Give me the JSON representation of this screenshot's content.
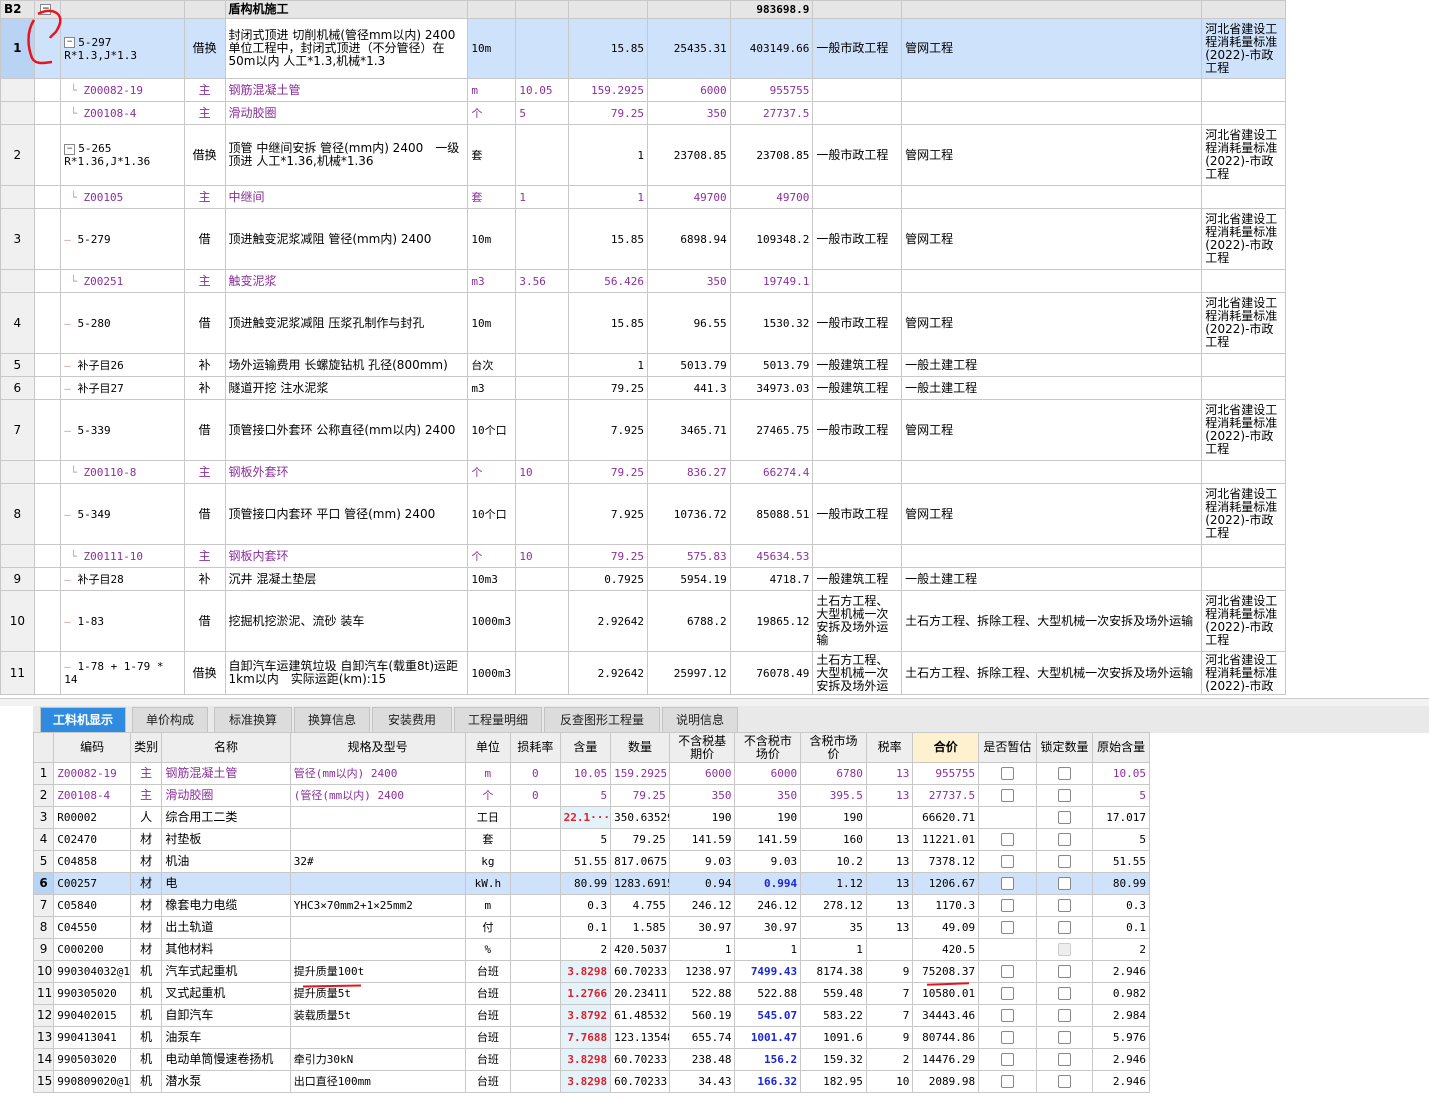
{
  "upper": {
    "title_row": {
      "code": "B2",
      "name": "盾构机施工",
      "total": "983698.9"
    },
    "rows": [
      {
        "num": "1",
        "code": "5-297",
        "code2": "R*1.3,J*1.3",
        "type": "借换",
        "name": "封闭式顶进 切削机械(管径mm以内) 2400 单位工程中，封闭式顶进（不分管径）在50m以内 人工*1.3,机械*1.3",
        "unit": "10m",
        "loss": "",
        "qty": "15.85",
        "price": "25435.31",
        "total": "403149.66",
        "prof": "一般市政工程",
        "cat": "管网工程",
        "std": "河北省建设工程消耗量标准(2022)-市政工程"
      },
      {
        "num": "",
        "code": "Z00082-19",
        "type": "主",
        "name": "钢筋混凝土管",
        "unit": "m",
        "loss": "10.05",
        "qty": "159.2925",
        "price": "6000",
        "total": "955755",
        "prof": "",
        "cat": "",
        "std": ""
      },
      {
        "num": "",
        "code": "Z00108-4",
        "type": "主",
        "name": "滑动胶圈",
        "unit": "个",
        "loss": "5",
        "qty": "79.25",
        "price": "350",
        "total": "27737.5",
        "prof": "",
        "cat": "",
        "std": ""
      },
      {
        "num": "2",
        "code": "5-265",
        "code2": "R*1.36,J*1.36",
        "type": "借换",
        "name": "顶管 中继间安拆 管径(mm内) 2400　一级顶进 人工*1.36,机械*1.36",
        "unit": "套",
        "loss": "",
        "qty": "1",
        "price": "23708.85",
        "total": "23708.85",
        "prof": "一般市政工程",
        "cat": "管网工程",
        "std": "河北省建设工程消耗量标准(2022)-市政工程"
      },
      {
        "num": "",
        "code": "Z00105",
        "type": "主",
        "name": "中继间",
        "unit": "套",
        "loss": "1",
        "qty": "1",
        "price": "49700",
        "total": "49700",
        "prof": "",
        "cat": "",
        "std": ""
      },
      {
        "num": "3",
        "code": "5-279",
        "type": "借",
        "name": "顶进触变泥浆减阻 管径(mm内) 2400",
        "unit": "10m",
        "loss": "",
        "qty": "15.85",
        "price": "6898.94",
        "total": "109348.2",
        "prof": "一般市政工程",
        "cat": "管网工程",
        "std": "河北省建设工程消耗量标准(2022)-市政工程"
      },
      {
        "num": "",
        "code": "Z00251",
        "type": "主",
        "name": "触变泥浆",
        "unit": "m3",
        "loss": "3.56",
        "qty": "56.426",
        "price": "350",
        "total": "19749.1",
        "prof": "",
        "cat": "",
        "std": ""
      },
      {
        "num": "4",
        "code": "5-280",
        "type": "借",
        "name": "顶进触变泥浆减阻 压浆孔制作与封孔",
        "unit": "10m",
        "loss": "",
        "qty": "15.85",
        "price": "96.55",
        "total": "1530.32",
        "prof": "一般市政工程",
        "cat": "管网工程",
        "std": "河北省建设工程消耗量标准(2022)-市政工程"
      },
      {
        "num": "5",
        "code": "补子目26",
        "type": "补",
        "name": "场外运输费用 长螺旋钻机 孔径(800mm)",
        "unit": "台次",
        "loss": "",
        "qty": "1",
        "price": "5013.79",
        "total": "5013.79",
        "prof": "一般建筑工程",
        "cat": "一般土建工程",
        "std": ""
      },
      {
        "num": "6",
        "code": "补子目27",
        "type": "补",
        "name": "隧道开挖 注水泥浆",
        "unit": "m3",
        "loss": "",
        "qty": "79.25",
        "price": "441.3",
        "total": "34973.03",
        "prof": "一般建筑工程",
        "cat": "一般土建工程",
        "std": ""
      },
      {
        "num": "7",
        "code": "5-339",
        "type": "借",
        "name": "顶管接口外套环 公称直径(mm以内) 2400",
        "unit": "10个口",
        "loss": "",
        "qty": "7.925",
        "price": "3465.71",
        "total": "27465.75",
        "prof": "一般市政工程",
        "cat": "管网工程",
        "std": "河北省建设工程消耗量标准(2022)-市政工程"
      },
      {
        "num": "",
        "code": "Z00110-8",
        "type": "主",
        "name": "钢板外套环",
        "unit": "个",
        "loss": "10",
        "qty": "79.25",
        "price": "836.27",
        "total": "66274.4",
        "prof": "",
        "cat": "",
        "std": ""
      },
      {
        "num": "8",
        "code": "5-349",
        "type": "借",
        "name": "顶管接口内套环 平口 管径(mm) 2400",
        "unit": "10个口",
        "loss": "",
        "qty": "7.925",
        "price": "10736.72",
        "total": "85088.51",
        "prof": "一般市政工程",
        "cat": "管网工程",
        "std": "河北省建设工程消耗量标准(2022)-市政工程"
      },
      {
        "num": "",
        "code": "Z00111-10",
        "type": "主",
        "name": "钢板内套环",
        "unit": "个",
        "loss": "10",
        "qty": "79.25",
        "price": "575.83",
        "total": "45634.53",
        "prof": "",
        "cat": "",
        "std": ""
      },
      {
        "num": "9",
        "code": "补子目28",
        "type": "补",
        "name": "沉井 混凝土垫层",
        "unit": "10m3",
        "loss": "",
        "qty": "0.7925",
        "price": "5954.19",
        "total": "4718.7",
        "prof": "一般建筑工程",
        "cat": "一般土建工程",
        "std": ""
      },
      {
        "num": "10",
        "code": "1-83",
        "type": "借",
        "name": "挖掘机挖淤泥、流砂 装车",
        "unit": "1000m3",
        "loss": "",
        "qty": "2.92642",
        "price": "6788.2",
        "total": "19865.12",
        "prof": "土石方工程、大型机械一次安拆及场外运输",
        "cat": "土石方工程、拆除工程、大型机械一次安拆及场外运输",
        "std": "河北省建设工程消耗量标准(2022)-市政工程"
      },
      {
        "num": "11",
        "code": "1-78 + 1-79 * 14",
        "type": "借换",
        "name": "自卸汽车运建筑垃圾 自卸汽车(载重8t)运距1km以内　实际运距(km):15",
        "unit": "1000m3",
        "loss": "",
        "qty": "2.92642",
        "price": "25997.12",
        "total": "76078.49",
        "prof": "土石方工程、大型机械一次安拆及场外运",
        "cat": "土石方工程、拆除工程、大型机械一次安拆及场外运输",
        "std": "河北省建设工程消耗量标准(2022)-市政"
      }
    ]
  },
  "tabs": [
    "工料机显示",
    "单价构成",
    "标准换算",
    "换算信息",
    "安装费用",
    "工程量明细",
    "反查图形工程量",
    "说明信息"
  ],
  "lower": {
    "headers": [
      "编码",
      "类别",
      "名称",
      "规格及型号",
      "单位",
      "损耗率",
      "含量",
      "数量",
      "不含税基期价",
      "不含税市场价",
      "含税市场价",
      "税率",
      "合价",
      "是否暂估",
      "锁定数量",
      "原始含量"
    ],
    "rows": [
      {
        "num": "1",
        "code": "Z00082-19",
        "cat": "主",
        "name": "钢筋混凝土管",
        "spec": "管径(mm以内) 2400",
        "unit": "m",
        "loss": "0",
        "content": "10.05",
        "qty": "159.2925",
        "base": "6000",
        "market": "6000",
        "taxmarket": "6780",
        "rate": "13",
        "total": "955755",
        "orig": "10.05"
      },
      {
        "num": "2",
        "code": "Z00108-4",
        "cat": "主",
        "name": "滑动胶圈",
        "spec": "(管径(mm以内) 2400",
        "unit": "个",
        "loss": "0",
        "content": "5",
        "qty": "79.25",
        "base": "350",
        "market": "350",
        "taxmarket": "395.5",
        "rate": "13",
        "total": "27737.5",
        "orig": "5"
      },
      {
        "num": "3",
        "code": "R00002",
        "cat": "人",
        "name": "综合用工二类",
        "spec": "",
        "unit": "工日",
        "loss": "",
        "content": "22.1···",
        "qty": "350.63529",
        "base": "190",
        "market": "190",
        "taxmarket": "190",
        "rate": "",
        "total": "66620.71",
        "orig": "17.017"
      },
      {
        "num": "4",
        "code": "C02470",
        "cat": "材",
        "name": "衬垫板",
        "spec": "",
        "unit": "套",
        "loss": "",
        "content": "5",
        "qty": "79.25",
        "base": "141.59",
        "market": "141.59",
        "taxmarket": "160",
        "rate": "13",
        "total": "11221.01",
        "orig": "5"
      },
      {
        "num": "5",
        "code": "C04858",
        "cat": "材",
        "name": "机油",
        "spec": "32#",
        "unit": "kg",
        "loss": "",
        "content": "51.55",
        "qty": "817.0675",
        "base": "9.03",
        "market": "9.03",
        "taxmarket": "10.2",
        "rate": "13",
        "total": "7378.12",
        "orig": "51.55"
      },
      {
        "num": "6",
        "code": "C00257",
        "cat": "材",
        "name": "电",
        "spec": "",
        "unit": "kW.h",
        "loss": "",
        "content": "80.99",
        "qty": "1283.6915",
        "base": "0.94",
        "market": "0.994",
        "taxmarket": "1.12",
        "rate": "13",
        "total": "1206.67",
        "orig": "80.99"
      },
      {
        "num": "7",
        "code": "C05840",
        "cat": "材",
        "name": "橡套电力电缆",
        "spec": "YHC3×70mm2+1×25mm2",
        "unit": "m",
        "loss": "",
        "content": "0.3",
        "qty": "4.755",
        "base": "246.12",
        "market": "246.12",
        "taxmarket": "278.12",
        "rate": "13",
        "total": "1170.3",
        "orig": "0.3"
      },
      {
        "num": "8",
        "code": "C04550",
        "cat": "材",
        "name": "出土轨道",
        "spec": "",
        "unit": "付",
        "loss": "",
        "content": "0.1",
        "qty": "1.585",
        "base": "30.97",
        "market": "30.97",
        "taxmarket": "35",
        "rate": "13",
        "total": "49.09",
        "orig": "0.1"
      },
      {
        "num": "9",
        "code": "C000200",
        "cat": "材",
        "name": "其他材料",
        "spec": "",
        "unit": "%",
        "loss": "",
        "content": "2",
        "qty": "420.5037",
        "base": "1",
        "market": "1",
        "taxmarket": "1",
        "rate": "",
        "total": "420.5",
        "orig": "2"
      },
      {
        "num": "10",
        "code": "990304032@1",
        "cat": "机",
        "name": "汽车式起重机",
        "spec": "提升质量100t",
        "unit": "台班",
        "loss": "",
        "content": "3.8298",
        "qty": "60.70233",
        "base": "1238.97",
        "market": "7499.43",
        "taxmarket": "8174.38",
        "rate": "9",
        "total": "75208.37",
        "orig": "2.946"
      },
      {
        "num": "11",
        "code": "990305020",
        "cat": "机",
        "name": "叉式起重机",
        "spec": "提升质量5t",
        "unit": "台班",
        "loss": "",
        "content": "1.2766",
        "qty": "20.23411",
        "base": "522.88",
        "market": "522.88",
        "taxmarket": "559.48",
        "rate": "7",
        "total": "10580.01",
        "orig": "0.982"
      },
      {
        "num": "12",
        "code": "990402015",
        "cat": "机",
        "name": "自卸汽车",
        "spec": "装载质量5t",
        "unit": "台班",
        "loss": "",
        "content": "3.8792",
        "qty": "61.48532",
        "base": "560.19",
        "market": "545.07",
        "taxmarket": "583.22",
        "rate": "7",
        "total": "34443.46",
        "orig": "2.984"
      },
      {
        "num": "13",
        "code": "990413041",
        "cat": "机",
        "name": "油泵车",
        "spec": "",
        "unit": "台班",
        "loss": "",
        "content": "7.7688",
        "qty": "123.13548",
        "base": "655.74",
        "market": "1001.47",
        "taxmarket": "1091.6",
        "rate": "9",
        "total": "80744.86",
        "orig": "5.976"
      },
      {
        "num": "14",
        "code": "990503020",
        "cat": "机",
        "name": "电动单筒慢速卷扬机",
        "spec": "牵引力30kN",
        "unit": "台班",
        "loss": "",
        "content": "3.8298",
        "qty": "60.70233",
        "base": "238.48",
        "market": "156.2",
        "taxmarket": "159.32",
        "rate": "2",
        "total": "14476.29",
        "orig": "2.946"
      },
      {
        "num": "15",
        "code": "990809020@1",
        "cat": "机",
        "name": "潜水泵",
        "spec": "出口直径100mm",
        "unit": "台班",
        "loss": "",
        "content": "3.8298",
        "qty": "60.70233",
        "base": "34.43",
        "market": "166.32",
        "taxmarket": "182.95",
        "rate": "10",
        "total": "2089.98",
        "orig": "2.946"
      }
    ]
  }
}
